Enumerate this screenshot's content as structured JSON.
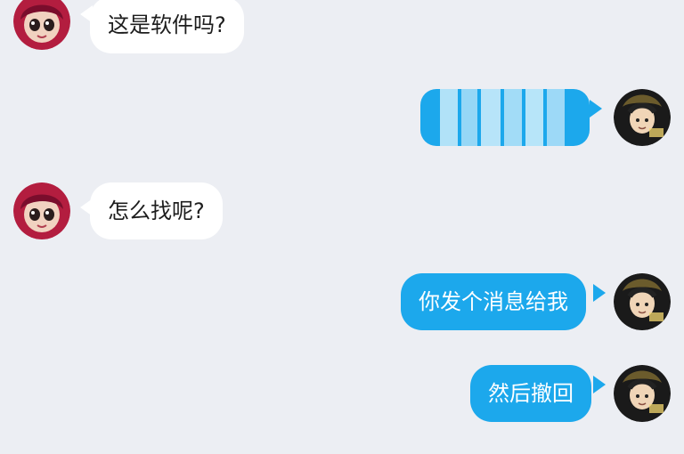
{
  "messages": [
    {
      "side": "left",
      "text": "这是软件吗?",
      "avatar": "female-avatar"
    },
    {
      "side": "right",
      "text": "",
      "avatar": "male-avatar",
      "blurred": true
    },
    {
      "side": "left",
      "text": "怎么找呢?",
      "avatar": "female-avatar"
    },
    {
      "side": "right",
      "text": "你发个消息给我",
      "avatar": "male-avatar"
    },
    {
      "side": "right",
      "text": "然后撤回",
      "avatar": "male-avatar"
    }
  ],
  "colors": {
    "background": "#eceef3",
    "outgoing_bubble": "#1ca8ec",
    "incoming_bubble": "#ffffff"
  }
}
